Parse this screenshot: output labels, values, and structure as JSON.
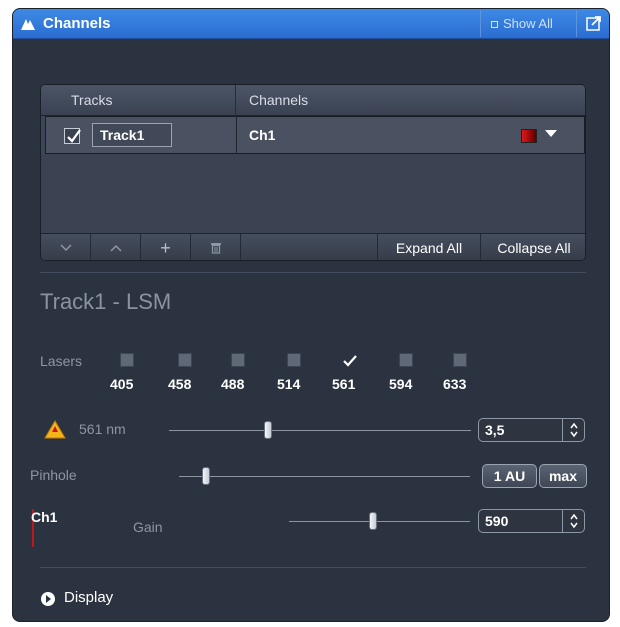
{
  "window": {
    "title": "Channels",
    "show_all_label": "Show All",
    "icons": {
      "app": "microscope-icon",
      "undock": "undock-icon"
    }
  },
  "tracks_table": {
    "headers": {
      "tracks": "Tracks",
      "channels": "Channels"
    },
    "rows": [
      {
        "checked": true,
        "track": "Track1",
        "channel": "Ch1",
        "channel_color": "#e21717"
      }
    ],
    "footer": {
      "move_down_icon": "chevron-down-icon",
      "move_up_icon": "chevron-up-icon",
      "add_label": "+",
      "delete_icon": "trash-icon",
      "expand_all": "Expand All",
      "collapse_all": "Collapse All"
    }
  },
  "track_section": {
    "title": "Track1 - LSM",
    "lasers_label": "Lasers",
    "lasers": [
      {
        "nm": "405",
        "on": false
      },
      {
        "nm": "458",
        "on": false
      },
      {
        "nm": "488",
        "on": false
      },
      {
        "nm": "514",
        "on": false
      },
      {
        "nm": "561",
        "on": true
      },
      {
        "nm": "594",
        "on": false
      },
      {
        "nm": "633",
        "on": false
      }
    ],
    "laser_power": {
      "label": "561 nm",
      "value": "3,5",
      "warning_icon": "laser-warning-icon"
    },
    "pinhole": {
      "label": "Pinhole",
      "au_button": "1 AU",
      "max_button": "max"
    },
    "channel": {
      "name": "Ch1",
      "gain_label": "Gain",
      "gain_value": "590"
    }
  },
  "display": {
    "label": "Display",
    "icon": "expand-arrow-icon"
  }
}
